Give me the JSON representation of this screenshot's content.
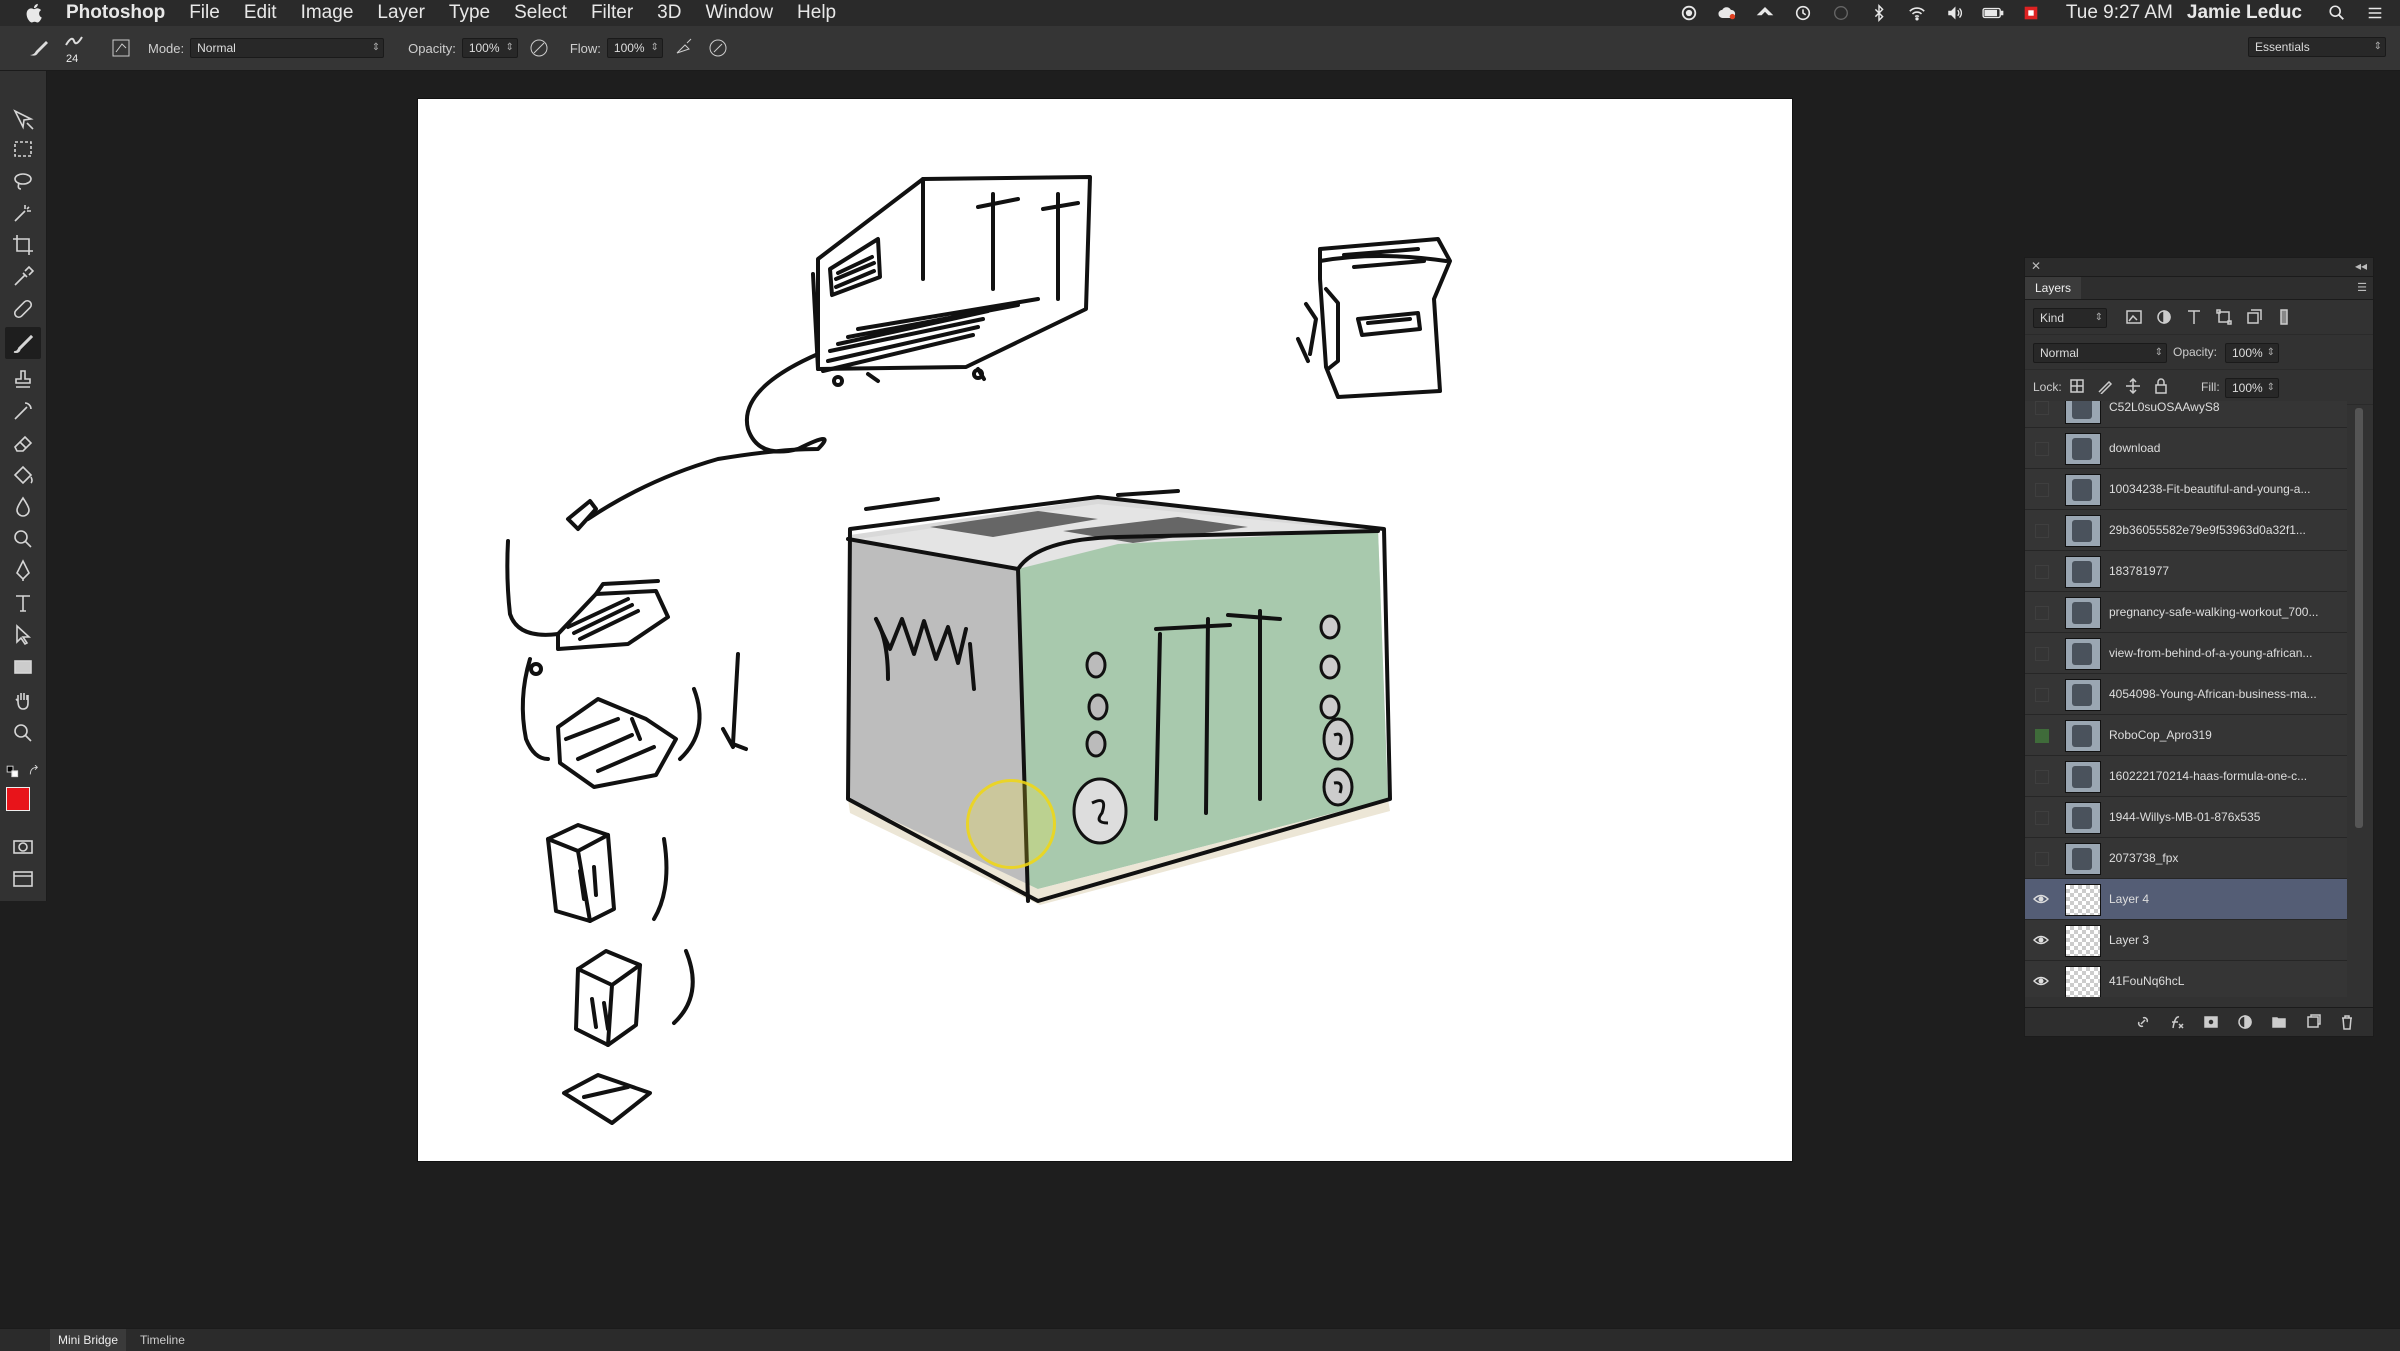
{
  "menubar": {
    "app_name": "Photoshop",
    "menus": [
      "File",
      "Edit",
      "Image",
      "Layer",
      "Type",
      "Select",
      "Filter",
      "3D",
      "Window",
      "Help"
    ],
    "clock": "Tue 9:27 AM",
    "user": "Jamie Leduc"
  },
  "options": {
    "brush_size": "24",
    "mode_label": "Mode:",
    "mode_value": "Normal",
    "opacity_label": "Opacity:",
    "opacity_value": "100%",
    "flow_label": "Flow:",
    "flow_value": "100%",
    "workspace": "Essentials"
  },
  "colors": {
    "foreground": "#e8141a",
    "background": "#ffffff",
    "toaster_green": "#a8c9ad"
  },
  "layers_panel": {
    "title": "Layers",
    "filter_kind": "Kind",
    "blend_mode": "Normal",
    "opacity_label": "Opacity:",
    "opacity_value": "100%",
    "lock_label": "Lock:",
    "fill_label": "Fill:",
    "fill_value": "100%",
    "layers": [
      {
        "name": "C52L0suOSAAwyS8",
        "visible": false,
        "thumb": "photo"
      },
      {
        "name": "download",
        "visible": false,
        "thumb": "photo"
      },
      {
        "name": "10034238-Fit-beautiful-and-young-a...",
        "visible": false,
        "thumb": "photo"
      },
      {
        "name": "29b36055582e79e9f53963d0a32f1...",
        "visible": false,
        "thumb": "photo"
      },
      {
        "name": "183781977",
        "visible": false,
        "thumb": "photo"
      },
      {
        "name": "pregnancy-safe-walking-workout_700...",
        "visible": false,
        "thumb": "photo"
      },
      {
        "name": "view-from-behind-of-a-young-african...",
        "visible": false,
        "thumb": "photo"
      },
      {
        "name": "4054098-Young-African-business-ma...",
        "visible": false,
        "thumb": "photo"
      },
      {
        "name": "RoboCop_Apro319",
        "visible": false,
        "thumb": "photo",
        "green": true
      },
      {
        "name": "160222170214-haas-formula-one-c...",
        "visible": false,
        "thumb": "photo"
      },
      {
        "name": "1944-Willys-MB-01-876x535",
        "visible": false,
        "thumb": "photo"
      },
      {
        "name": "2073738_fpx",
        "visible": false,
        "thumb": "photo"
      },
      {
        "name": "Layer 4",
        "visible": true,
        "thumb": "transparent",
        "selected": true
      },
      {
        "name": "Layer 3",
        "visible": true,
        "thumb": "transparent"
      },
      {
        "name": "41FouNq6hcL",
        "visible": true,
        "thumb": "transparent"
      }
    ]
  },
  "statusbar": {
    "tabs": [
      "Mini Bridge",
      "Timeline"
    ]
  }
}
